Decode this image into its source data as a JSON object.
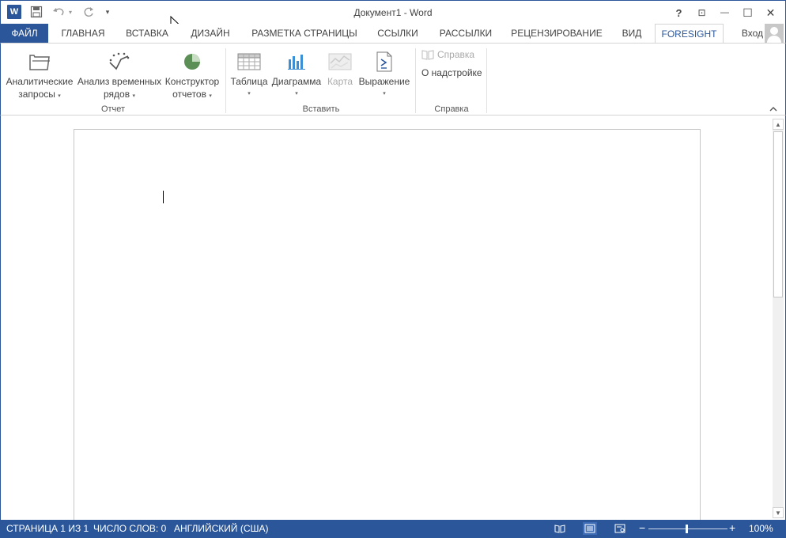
{
  "titlebar": {
    "title": "Документ1 - Word",
    "help": "?",
    "ribbon_display": "⊡",
    "minimize": "—",
    "maximize": "☐",
    "close": "✕",
    "qat": {
      "word_logo": "W",
      "save_icon": "save-icon",
      "undo_icon": "undo-icon",
      "redo_icon": "redo-icon",
      "customize": "▾"
    }
  },
  "tabs": {
    "file": "ФАЙЛ",
    "home": "ГЛАВНАЯ",
    "insert": "ВСТАВКА",
    "design": "ДИЗАЙН",
    "layout": "РАЗМЕТКА СТРАНИЦЫ",
    "references": "ССЫЛКИ",
    "mailings": "РАССЫЛКИ",
    "review": "РЕЦЕНЗИРОВАНИЕ",
    "view": "ВИД",
    "foresight": "FORESIGHT",
    "login": "Вход"
  },
  "ribbon": {
    "report": {
      "analytic_line1": "Аналитические",
      "analytic_line2": "запросы",
      "timeseries_line1": "Анализ временных",
      "timeseries_line2": "рядов",
      "builder_line1": "Конструктор",
      "builder_line2": "отчетов",
      "label": "Отчет"
    },
    "insert": {
      "table": "Таблица",
      "chart": "Диаграмма",
      "map": "Карта",
      "expression": "Выражение",
      "label": "Вставить"
    },
    "help": {
      "help_btn": "Справка",
      "about": "О надстройке",
      "label": "Справка"
    },
    "caret": "▾"
  },
  "statusbar": {
    "page": "СТРАНИЦА 1 ИЗ 1",
    "words": "ЧИСЛО СЛОВ: 0",
    "language": "АНГЛИЙСКИЙ (США)",
    "zoom_minus": "−",
    "zoom_plus": "+",
    "zoom": "100%"
  },
  "colors": {
    "accent": "#2b579a",
    "statusbar": "#2b579a"
  }
}
